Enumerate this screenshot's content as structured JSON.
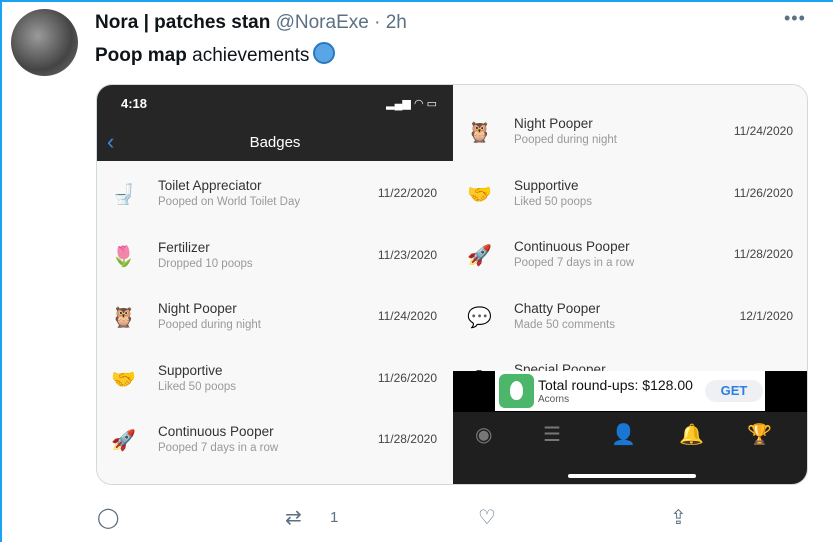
{
  "tweet": {
    "name": "Nora | patches stan",
    "handle": "@NoraExe",
    "sep": "·",
    "time": "2h",
    "text_bold": "Poop map",
    "text_rest": "achievements",
    "more": "•••"
  },
  "phone": {
    "time": "4:18",
    "title": "Badges",
    "back": "‹",
    "left_rows": [
      {
        "icon": "toilet-icon",
        "glyph": "🚽",
        "name": "Toilet Appreciator",
        "sub": "Pooped on World Toilet Day",
        "date": "11/22/2020"
      },
      {
        "icon": "tulip-icon",
        "glyph": "🌷",
        "name": "Fertilizer",
        "sub": "Dropped 10 poops",
        "date": "11/23/2020"
      },
      {
        "icon": "owl-icon",
        "glyph": "🦉",
        "name": "Night Pooper",
        "sub": "Pooped during night",
        "date": "11/24/2020"
      },
      {
        "icon": "handshake-icon",
        "glyph": "🤝",
        "name": "Supportive",
        "sub": "Liked 50 poops",
        "date": "11/26/2020"
      },
      {
        "icon": "rocket-icon",
        "glyph": "🚀",
        "name": "Continuous Pooper",
        "sub": "Pooped 7 days in a row",
        "date": "11/28/2020"
      }
    ],
    "right_rows": [
      {
        "icon": "owl-icon",
        "glyph": "🦉",
        "name": "Night Pooper",
        "sub": "Pooped during night",
        "date": "11/24/2020"
      },
      {
        "icon": "handshake-icon",
        "glyph": "🤝",
        "name": "Supportive",
        "sub": "Liked 50 poops",
        "date": "11/26/2020"
      },
      {
        "icon": "rocket-icon",
        "glyph": "🚀",
        "name": "Continuous Pooper",
        "sub": "Pooped 7 days in a row",
        "date": "11/28/2020"
      },
      {
        "icon": "speech-bubble-icon",
        "glyph": "💬",
        "name": "Chatty Pooper",
        "sub": "Made 50 comments",
        "date": "12/1/2020"
      },
      {
        "icon": "special-icon",
        "glyph": "✪",
        "name": "Special Pooper",
        "sub": "",
        "date": ""
      }
    ],
    "ad": {
      "title": "Total round-ups: $128.00",
      "brand": "Acorns",
      "cta": "GET"
    },
    "nav": [
      {
        "icon": "globe-icon",
        "glyph": "◉"
      },
      {
        "icon": "list-icon",
        "glyph": "☰"
      },
      {
        "icon": "profile-icon",
        "glyph": "👤",
        "active": true
      },
      {
        "icon": "bell-icon",
        "glyph": "🔔"
      },
      {
        "icon": "trophy-icon",
        "glyph": "🏆"
      }
    ],
    "accent": "#2d9cf0"
  },
  "actions": {
    "retweets": "1"
  }
}
